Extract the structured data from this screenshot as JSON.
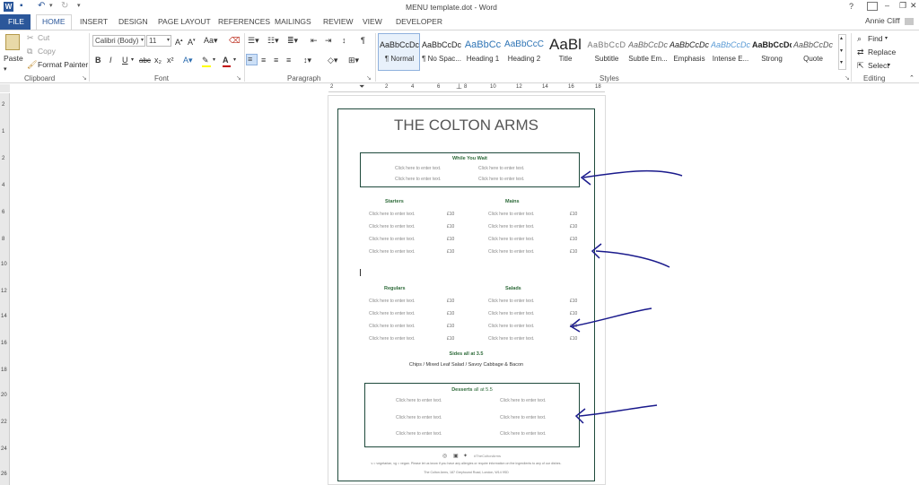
{
  "window": {
    "title": "MENU template.dot - Word",
    "user": "Annie Cliff",
    "help": "?",
    "minimize": "–",
    "restore": "❐",
    "close": "✕"
  },
  "tabs": [
    "FILE",
    "HOME",
    "INSERT",
    "DESIGN",
    "PAGE LAYOUT",
    "REFERENCES",
    "MAILINGS",
    "REVIEW",
    "VIEW",
    "DEVELOPER"
  ],
  "clipboard": {
    "paste": "Paste",
    "cut": "Cut",
    "copy": "Copy",
    "format_painter": "Format Painter",
    "label": "Clipboard"
  },
  "font": {
    "name": "Calibri (Body)",
    "size": "11",
    "label": "Font",
    "bold": "B",
    "italic": "I",
    "underline": "U",
    "strike": "abc",
    "sub": "x₂",
    "sup": "x²"
  },
  "paragraph": {
    "label": "Paragraph"
  },
  "styles": {
    "label": "Styles",
    "items": [
      {
        "preview": "AaBbCcDc",
        "name": "¶ Normal"
      },
      {
        "preview": "AaBbCcDc",
        "name": "¶ No Spac..."
      },
      {
        "preview": "AaBbCc",
        "name": "Heading 1"
      },
      {
        "preview": "AaBbCcC",
        "name": "Heading 2"
      },
      {
        "preview": "AaBl",
        "name": "Title"
      },
      {
        "preview": "AaBbCcD",
        "name": "Subtitle"
      },
      {
        "preview": "AaBbCcDc",
        "name": "Subtle Em..."
      },
      {
        "preview": "AaBbCcDc",
        "name": "Emphasis"
      },
      {
        "preview": "AaBbCcDc",
        "name": "Intense E..."
      },
      {
        "preview": "AaBbCcDc",
        "name": "Strong"
      },
      {
        "preview": "AaBbCcDc",
        "name": "Quote"
      }
    ]
  },
  "editing": {
    "find": "Find",
    "replace": "Replace",
    "select": "Select",
    "label": "Editing"
  },
  "ruler": {
    "h": [
      "2",
      "2",
      "4",
      "6",
      "8",
      "10",
      "12",
      "14",
      "16",
      "18"
    ],
    "v": [
      "2",
      "1",
      "2",
      "4",
      "6",
      "8",
      "10",
      "12",
      "14",
      "16",
      "18",
      "20",
      "22",
      "24",
      "26"
    ]
  },
  "doc": {
    "title": "THE COLTON ARMS",
    "wait_heading": "While You Wait",
    "placeholder": "Click here to enter text.",
    "starters": "Starters",
    "mains": "Mains",
    "regulars": "Regulars",
    "salads": "Salads",
    "price": "£10",
    "sides_heading": "Sides all at 3.5",
    "sides_text": "Chips / Mixed Leaf Salad / Savoy Cabbage & Bacon",
    "desserts_heading": "Desserts",
    "desserts_suffix": "all at 5.5",
    "hashtag": "#TheColtonArms",
    "footnote": "v = vegetarian, vg = vegan. Please let us know if you have any allergies or require information on the ingredients to any of our dishes.",
    "address": "The Colton Arms, 187 Greyhound Road, London, W14 9SD"
  },
  "colors": {
    "accent": "#2b579a",
    "green": "#2e6b3a",
    "border": "#1f4a3c",
    "ink": "#1a1a8c"
  }
}
